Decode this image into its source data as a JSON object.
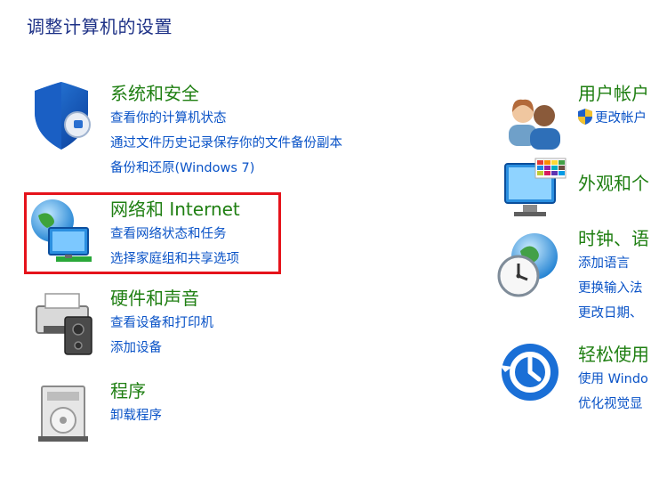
{
  "page_title": "调整计算机的设置",
  "left": [
    {
      "title": "系统和安全",
      "icon": "shield-icon",
      "links": [
        "查看你的计算机状态",
        "通过文件历史记录保存你的文件备份副本",
        "备份和还原(Windows 7)"
      ]
    },
    {
      "title": "网络和 Internet",
      "icon": "network-globe-icon",
      "links": [
        "查看网络状态和任务",
        "选择家庭组和共享选项"
      ]
    },
    {
      "title": "硬件和声音",
      "icon": "printer-speaker-icon",
      "links": [
        "查看设备和打印机",
        "添加设备"
      ]
    },
    {
      "title": "程序",
      "icon": "program-disc-icon",
      "links": [
        "卸载程序"
      ]
    }
  ],
  "right": [
    {
      "title": "用户帐户",
      "icon": "users-icon",
      "links": [
        "更改帐户"
      ]
    },
    {
      "title": "外观和个",
      "icon": "monitor-palette-icon",
      "links": []
    },
    {
      "title": "时钟、语",
      "icon": "clock-globe-icon",
      "links": [
        "添加语言",
        "更换输入法",
        "更改日期、"
      ]
    },
    {
      "title": "轻松使用",
      "icon": "ease-of-access-icon",
      "links": [
        "使用 Windo",
        "优化视觉显"
      ]
    }
  ],
  "colors": {
    "title_blue": "#1e3287",
    "category_green": "#1f7f12",
    "link_blue": "#0a53c7",
    "highlight_red": "#e5131b"
  }
}
